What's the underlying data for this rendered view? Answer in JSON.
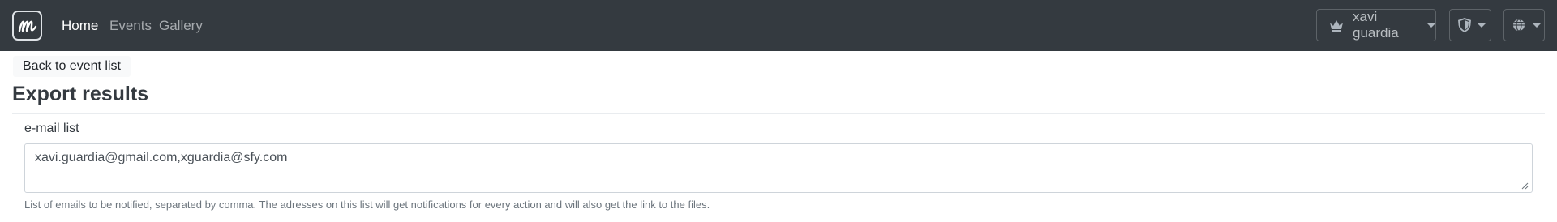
{
  "navbar": {
    "brand_icon": "m-logo-icon",
    "links": [
      {
        "label": "Home",
        "active": true
      },
      {
        "label": "Events",
        "active": false
      },
      {
        "label": "Gallery",
        "active": false
      }
    ],
    "user": {
      "icon": "crown-icon",
      "name": "xavi guardia"
    },
    "admin_menu": {
      "icon": "shield-icon"
    },
    "language_menu": {
      "icon": "globe-icon"
    }
  },
  "back_button": {
    "label": "Back to event list"
  },
  "page": {
    "title": "Export results"
  },
  "email_field": {
    "label": "e-mail list",
    "value": "xavi.guardia@gmail.com,xguardia@sfy.com",
    "help": "List of emails to be notified, separated by comma. The adresses on this list will get notifications for every action and will also get the link to the files."
  },
  "colors": {
    "navbar_bg": "#343a40",
    "active_link": "#ffffff",
    "inactive_link": "#a7abaf"
  }
}
